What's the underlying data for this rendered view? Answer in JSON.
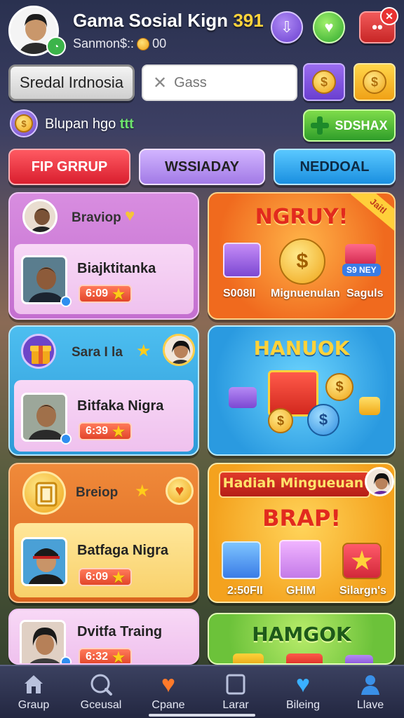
{
  "header": {
    "title": "Gama Sosial Kign",
    "title_number": "391",
    "subtitle": "Sanmon$::",
    "coin_amount": "00"
  },
  "toolbar": {
    "region_label": "Sredal Irdnosia",
    "search_placeholder": "Gass"
  },
  "status": {
    "text": "Blupan hgo",
    "suffix": "ttt",
    "green_button_label": "SDSHAX"
  },
  "tabs": [
    {
      "label": "FIP GRRUP"
    },
    {
      "label": "WSSIADAY"
    },
    {
      "label": "NEDDOAL"
    }
  ],
  "cards": [
    {
      "group_name": "Braviop",
      "person": "Biajktitanka",
      "price": "6:09"
    },
    {
      "group_name": "Sara I la",
      "person": "Bitfaka Nigra",
      "price": "6:39"
    },
    {
      "group_name": "Breiop",
      "person": "Batfaga Nigra",
      "price": "6:09"
    },
    {
      "group_name": "",
      "person": "Dvitfa Traing",
      "price": "6:32"
    }
  ],
  "promos": [
    {
      "title": "NGRUY!",
      "corner": "Jaitl",
      "labels": [
        "S008II",
        "Mignuenulan",
        "Saguls"
      ],
      "badge": "S9 NEY"
    },
    {
      "title": "HANUOK"
    },
    {
      "banner": "Hadiah Mingueuan",
      "title": "BRAP!",
      "labels": [
        "2:50FII",
        "GHIM",
        "Silargn's"
      ]
    },
    {
      "title": "HAMGOK"
    }
  ],
  "nav": [
    {
      "label": "Graup",
      "icon": "home-icon"
    },
    {
      "label": "Gceusal",
      "icon": "search-icon"
    },
    {
      "label": "Cpane",
      "icon": "heart-icon"
    },
    {
      "label": "Larar",
      "icon": "square-icon"
    },
    {
      "label": "Bileing",
      "icon": "heart-icon"
    },
    {
      "label": "Llave",
      "icon": "profile-icon"
    }
  ],
  "colors": {
    "tab_red": "#d91e2e",
    "tab_purple": "#a27ae6",
    "tab_blue": "#1a8fe0",
    "accent_gold": "#ffd43b",
    "accent_green": "#2f9e2a"
  }
}
